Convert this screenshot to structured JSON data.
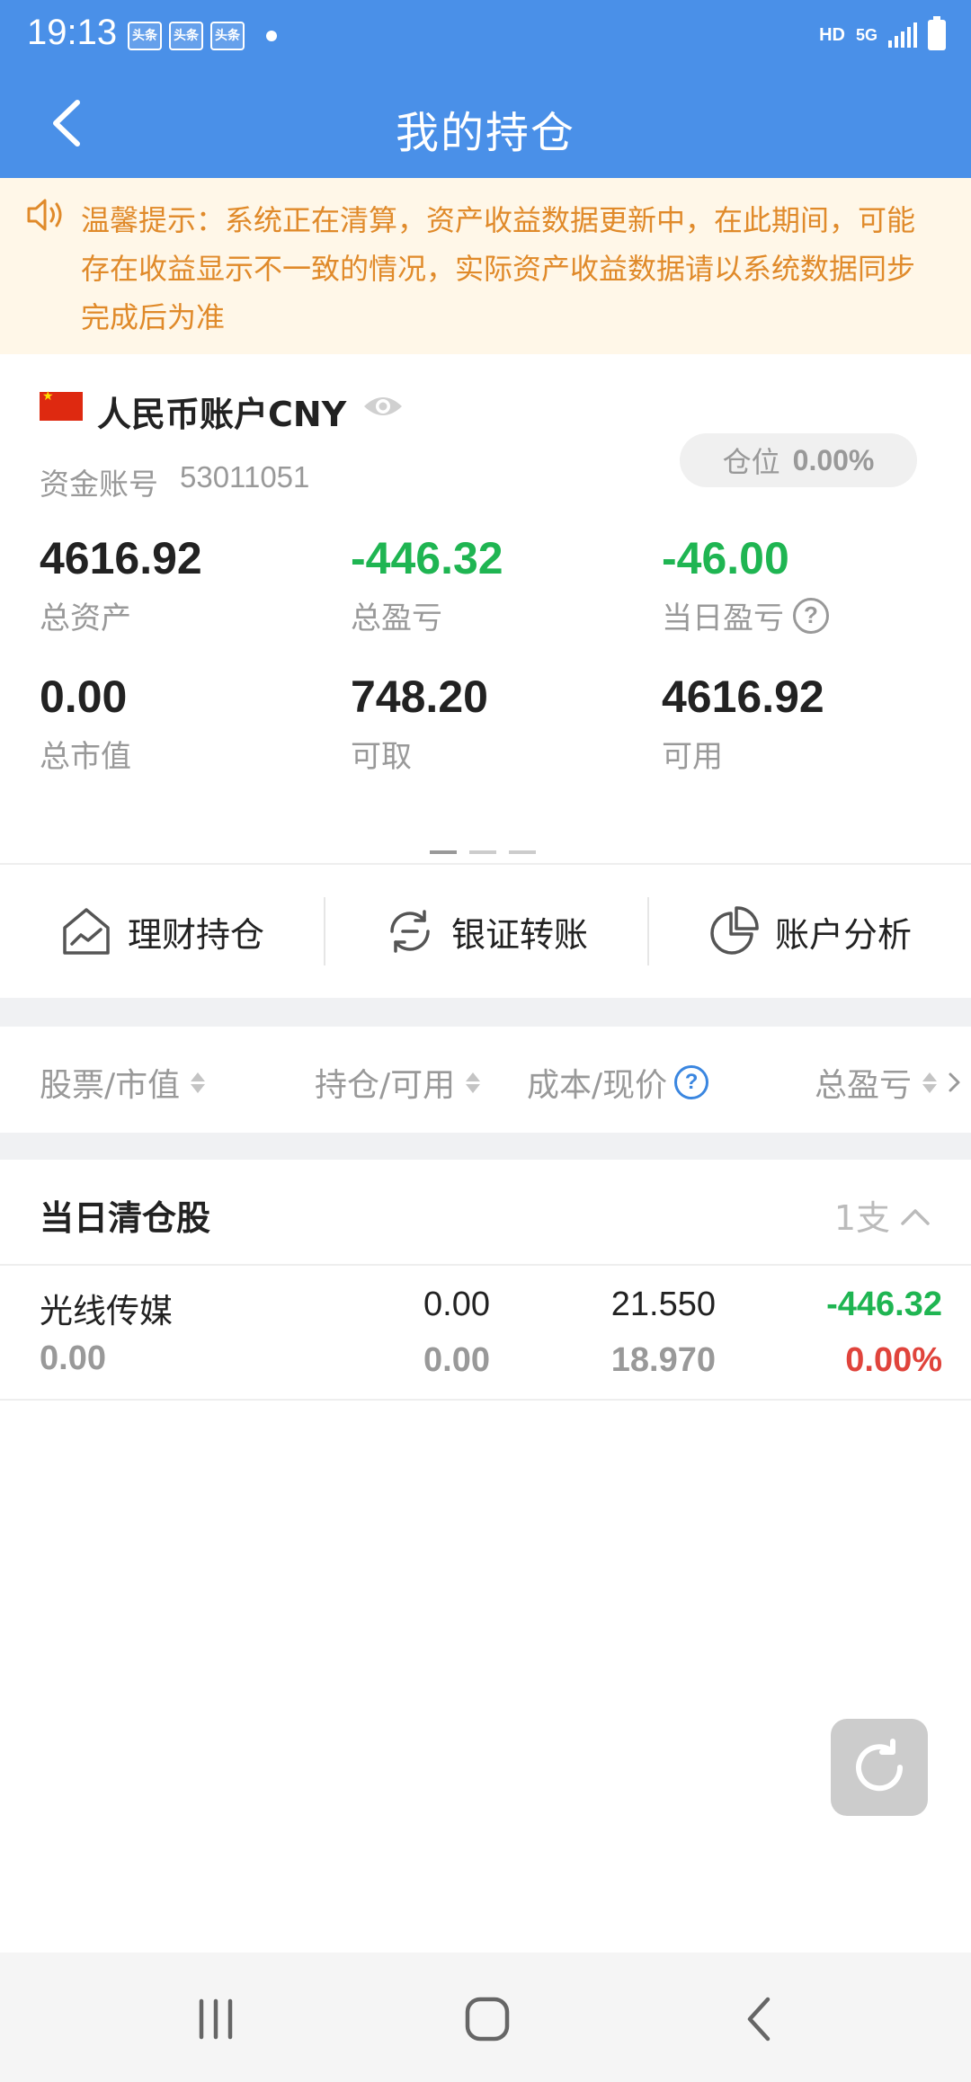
{
  "status_bar": {
    "time": "19:13",
    "notifications": [
      "头条",
      "头条",
      "头条"
    ],
    "hd": "HD",
    "network": "5G"
  },
  "header": {
    "title": "我的持仓"
  },
  "notice": {
    "text": "温馨提示：系统正在清算，资产收益数据更新中，在此期间，可能存在收益显示不一致的情况，实际资产收益数据请以系统数据同步完成后为准"
  },
  "account": {
    "name": "人民币账户CNY",
    "fund_account_label": "资金账号",
    "fund_account_no": "53011051",
    "position_label": "仓位",
    "position_value": "0.00%",
    "metrics": [
      {
        "value": "4616.92",
        "label": "总资产"
      },
      {
        "value": "-446.32",
        "label": "总盈亏"
      },
      {
        "value": "-46.00",
        "label": "当日盈亏"
      },
      {
        "value": "0.00",
        "label": "总市值"
      },
      {
        "value": "748.20",
        "label": "可取"
      },
      {
        "value": "4616.92",
        "label": "可用"
      }
    ]
  },
  "actions": [
    {
      "label": "理财持仓",
      "icon": "house-chart-icon"
    },
    {
      "label": "银证转账",
      "icon": "transfer-cycle-icon"
    },
    {
      "label": "账户分析",
      "icon": "pie-chart-icon"
    }
  ],
  "table_headers": [
    "股票/市值",
    "持仓/可用",
    "成本/现价",
    "总盈亏"
  ],
  "section": {
    "title": "当日清仓股",
    "count": "1支"
  },
  "holdings": [
    {
      "name": "光线传媒",
      "market_value": "0.00",
      "position": "0.00",
      "available": "0.00",
      "cost": "21.550",
      "price": "18.970",
      "total_pl": "-446.32",
      "total_pl_pct": "0.00%"
    }
  ],
  "colors": {
    "header_blue": "#4a90e8",
    "notice_orange": "#e08a2a",
    "loss_green": "#1fb552",
    "gain_red": "#e0443c"
  }
}
